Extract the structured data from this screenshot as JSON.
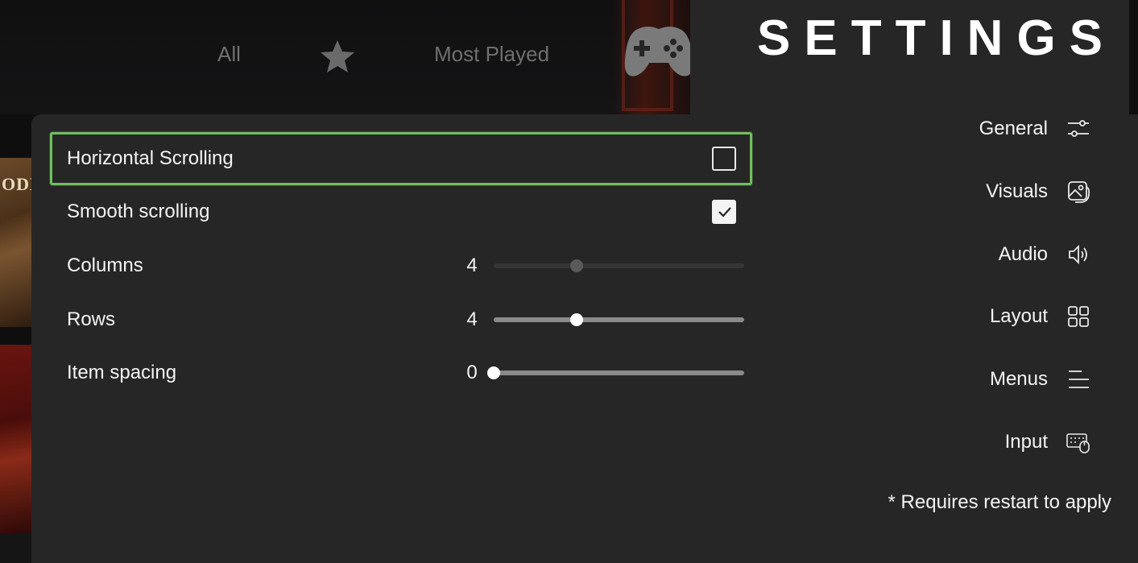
{
  "background": {
    "tabs": [
      {
        "label": "All"
      },
      {
        "label": ""
      },
      {
        "label": "Most Played"
      }
    ],
    "art_text": "ODD"
  },
  "options": [
    {
      "label": "Horizontal Scrolling",
      "type": "checkbox",
      "checked": false,
      "selected": true
    },
    {
      "label": "Smooth scrolling",
      "type": "checkbox",
      "checked": true,
      "selected": false
    },
    {
      "label": "Columns",
      "type": "slider",
      "value": "4",
      "fraction": 0.33,
      "enabled": false
    },
    {
      "label": "Rows",
      "type": "slider",
      "value": "4",
      "fraction": 0.33,
      "enabled": true
    },
    {
      "label": "Item spacing",
      "type": "slider",
      "value": "0",
      "fraction": 0.0,
      "enabled": true
    }
  ],
  "settings": {
    "title": "SETTINGS",
    "nav": [
      {
        "label": "General",
        "icon": "sliders-icon"
      },
      {
        "label": "Visuals",
        "icon": "image-icon"
      },
      {
        "label": "Audio",
        "icon": "speaker-icon"
      },
      {
        "label": "Layout",
        "icon": "grid-icon"
      },
      {
        "label": "Menus",
        "icon": "menu-lines-icon"
      },
      {
        "label": "Input",
        "icon": "keyboard-mouse-icon"
      }
    ],
    "note": "* Requires restart to apply"
  },
  "colors": {
    "panel": "#262626",
    "selection_border": "#6fbf5d",
    "text": "#f4f4f4",
    "dim_tab_text": "#6f6f6f"
  }
}
